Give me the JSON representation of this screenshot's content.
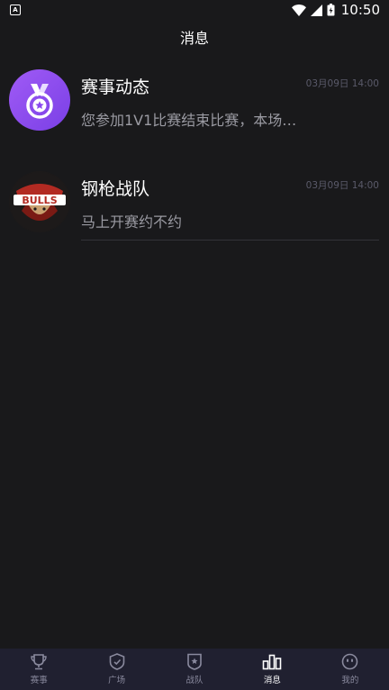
{
  "status_bar": {
    "app_badge": "A",
    "time": "10:50",
    "icons": [
      "wifi-icon",
      "signal-icon",
      "battery-icon"
    ]
  },
  "header": {
    "title": "消息"
  },
  "messages": [
    {
      "name": "赛事动态",
      "time": "03月09日 14:00",
      "preview": "您参加1V1比赛结束比赛，本场…",
      "avatar_icon": "medal-icon"
    },
    {
      "name": "钢枪战队",
      "time": "03月09日 14:00",
      "preview": "马上开赛约不约",
      "avatar_icon": "bulls-logo",
      "logo_text": "BULLS"
    }
  ],
  "bottom_nav": {
    "active": "消息",
    "items": [
      {
        "label": "赛事",
        "icon": "trophy-icon"
      },
      {
        "label": "广场",
        "icon": "shield-check-icon"
      },
      {
        "label": "战队",
        "icon": "team-badge-icon"
      },
      {
        "label": "消息",
        "icon": "message-bars-icon"
      },
      {
        "label": "我的",
        "icon": "profile-face-icon"
      }
    ]
  },
  "colors": {
    "background": "#19191b",
    "nav_background": "#202030",
    "nav_inactive": "#8a8a9e",
    "nav_active": "#ffffff",
    "preview_text": "#9a9aa2",
    "time_text": "#5a5a6a",
    "medal_avatar": "#9350f0"
  }
}
